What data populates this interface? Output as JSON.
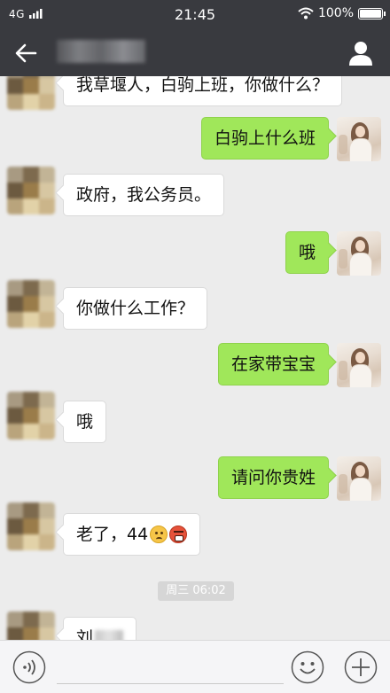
{
  "status_bar": {
    "network": "4G",
    "time": "21:45",
    "battery": "100%"
  },
  "nav": {
    "back_icon": "back-arrow-icon",
    "profile_icon": "person-icon"
  },
  "messages": [
    {
      "side": "left",
      "text": "我草堰人，白驹上班，你做什么？"
    },
    {
      "side": "right",
      "text": "白驹上什么班"
    },
    {
      "side": "left",
      "text": "政府，我公务员。"
    },
    {
      "side": "right",
      "text": "哦"
    },
    {
      "side": "left",
      "text": "你做什么工作？"
    },
    {
      "side": "right",
      "text": "在家带宝宝"
    },
    {
      "side": "left",
      "text": "哦"
    },
    {
      "side": "right",
      "text": "请问你贵姓"
    },
    {
      "side": "left",
      "text": "老了，44",
      "emojis": [
        "worried-face-icon",
        "angry-face-icon"
      ]
    },
    {
      "side": "left",
      "text": "刘"
    }
  ],
  "timestamp": "周三 06:02",
  "input_bar": {
    "voice_icon": "voice-icon",
    "emoji_icon": "smiley-icon",
    "plus_icon": "plus-icon"
  },
  "colors": {
    "header_bg": "#393a3f",
    "chat_bg": "#ececec",
    "sent_bubble": "#a0e75a",
    "received_bubble": "#ffffff"
  }
}
